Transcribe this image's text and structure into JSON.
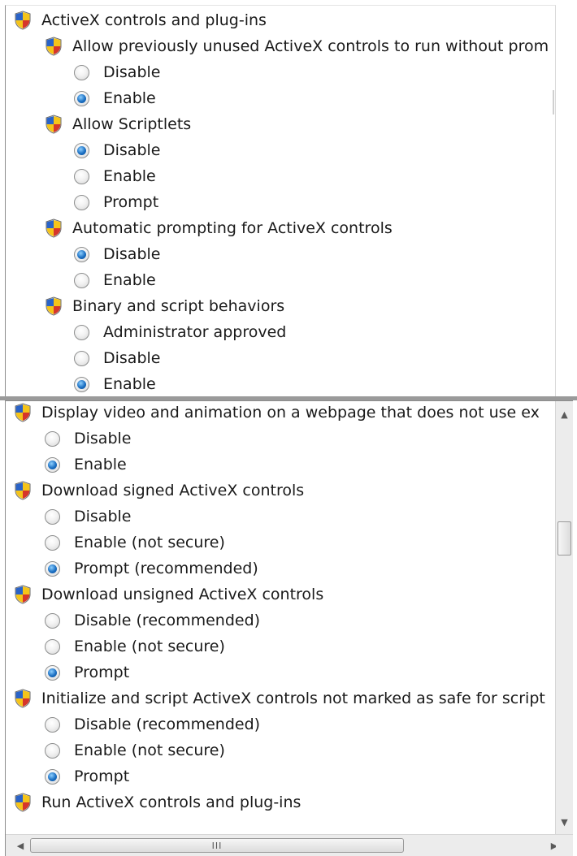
{
  "top_panel": {
    "items": [
      {
        "kind": "category",
        "label": "ActiveX controls and plug-ins",
        "indent": 0
      },
      {
        "kind": "category",
        "label": "Allow previously unused ActiveX controls to run without prom",
        "indent": 1
      },
      {
        "kind": "option",
        "label": "Disable",
        "checked": false
      },
      {
        "kind": "option",
        "label": "Enable",
        "checked": true
      },
      {
        "kind": "category",
        "label": "Allow Scriptlets",
        "indent": 1
      },
      {
        "kind": "option",
        "label": "Disable",
        "checked": true
      },
      {
        "kind": "option",
        "label": "Enable",
        "checked": false
      },
      {
        "kind": "option",
        "label": "Prompt",
        "checked": false
      },
      {
        "kind": "category",
        "label": "Automatic prompting for ActiveX controls",
        "indent": 1
      },
      {
        "kind": "option",
        "label": "Disable",
        "checked": true
      },
      {
        "kind": "option",
        "label": "Enable",
        "checked": false
      },
      {
        "kind": "category",
        "label": "Binary and script behaviors",
        "indent": 1
      },
      {
        "kind": "option",
        "label": "Administrator approved",
        "checked": false
      },
      {
        "kind": "option",
        "label": "Disable",
        "checked": false
      },
      {
        "kind": "option",
        "label": "Enable",
        "checked": true
      },
      {
        "kind": "category",
        "label": "Display video and animation on a webpage that does not use",
        "indent": 1
      }
    ]
  },
  "bottom_panel": {
    "items": [
      {
        "kind": "category",
        "label": "Display video and animation on a webpage that does not use ex"
      },
      {
        "kind": "option",
        "label": "Disable",
        "checked": false
      },
      {
        "kind": "option",
        "label": "Enable",
        "checked": true
      },
      {
        "kind": "category",
        "label": "Download signed ActiveX controls"
      },
      {
        "kind": "option",
        "label": "Disable",
        "checked": false
      },
      {
        "kind": "option",
        "label": "Enable (not secure)",
        "checked": false
      },
      {
        "kind": "option",
        "label": "Prompt (recommended)",
        "checked": true
      },
      {
        "kind": "category",
        "label": "Download unsigned ActiveX controls"
      },
      {
        "kind": "option",
        "label": "Disable (recommended)",
        "checked": false
      },
      {
        "kind": "option",
        "label": "Enable (not secure)",
        "checked": false
      },
      {
        "kind": "option",
        "label": "Prompt",
        "checked": true
      },
      {
        "kind": "category",
        "label": "Initialize and script ActiveX controls not marked as safe for script"
      },
      {
        "kind": "option",
        "label": "Disable (recommended)",
        "checked": false
      },
      {
        "kind": "option",
        "label": "Enable (not secure)",
        "checked": false
      },
      {
        "kind": "option",
        "label": "Prompt",
        "checked": true
      },
      {
        "kind": "category",
        "label": "Run ActiveX controls and plug-ins"
      }
    ],
    "hscroll_grip": "III"
  },
  "icons": {
    "category": "security-shield-icon",
    "scroll_up": "scroll-up-arrow-icon",
    "scroll_down": "scroll-down-arrow-icon",
    "scroll_left": "scroll-left-arrow-icon",
    "scroll_right": "scroll-right-arrow-icon"
  },
  "colors": {
    "shield_blue": "#2a63c7",
    "shield_yellow": "#f5c419",
    "shield_red": "#d6362b",
    "radio_checked": "#1b6fc2"
  }
}
